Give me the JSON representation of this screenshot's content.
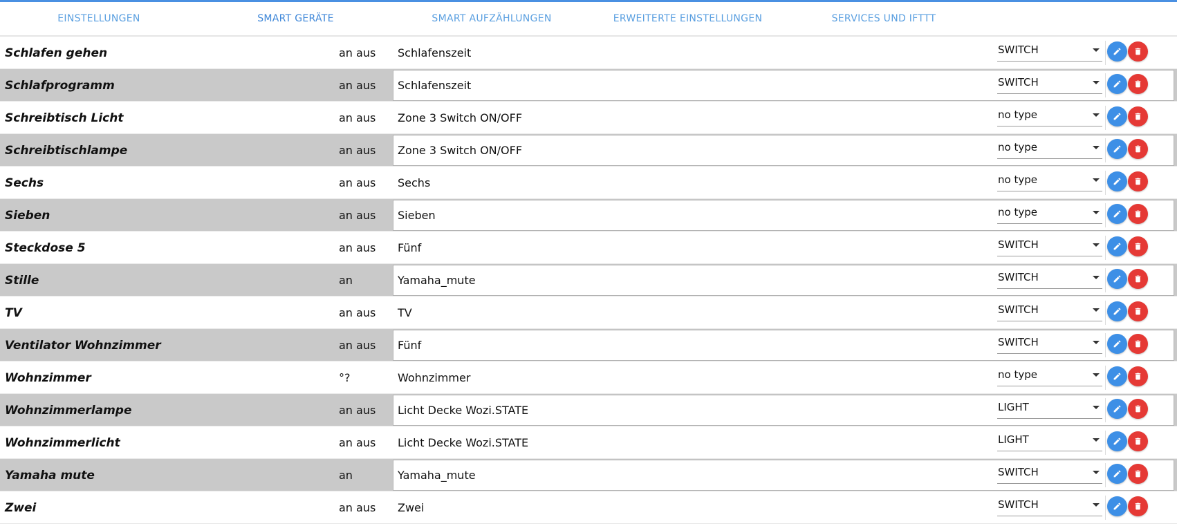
{
  "colors": {
    "accent": "#4a90e2",
    "tab_text": "#5a9fe0",
    "odd_row": "#c9c9c9",
    "edit_button": "#3d8fe6",
    "delete_button": "#e53935"
  },
  "tabs": [
    {
      "label": "EINSTELLUNGEN",
      "active": false
    },
    {
      "label": "SMART GERÄTE",
      "active": true
    },
    {
      "label": "SMART AUFZÄHLUNGEN",
      "active": false
    },
    {
      "label": "ERWEITERTE EINSTELLUNGEN",
      "active": false
    },
    {
      "label": "SERVICES UND IFTTT",
      "active": false
    }
  ],
  "devices": [
    {
      "name": "Schlafen gehen",
      "onoff": "an aus",
      "target": "Schlafenszeit",
      "type": "SWITCH"
    },
    {
      "name": "Schlafprogramm",
      "onoff": "an aus",
      "target": "Schlafenszeit",
      "type": "SWITCH"
    },
    {
      "name": "Schreibtisch Licht",
      "onoff": "an aus",
      "target": "Zone 3 Switch ON/OFF",
      "type": "no type"
    },
    {
      "name": "Schreibtischlampe",
      "onoff": "an aus",
      "target": "Zone 3 Switch ON/OFF",
      "type": "no type"
    },
    {
      "name": "Sechs",
      "onoff": "an aus",
      "target": "Sechs",
      "type": "no type"
    },
    {
      "name": "Sieben",
      "onoff": "an aus",
      "target": "Sieben",
      "type": "no type"
    },
    {
      "name": "Steckdose 5",
      "onoff": "an aus",
      "target": "Fünf",
      "type": "SWITCH"
    },
    {
      "name": "Stille",
      "onoff": "an",
      "target": "Yamaha_mute",
      "type": "SWITCH"
    },
    {
      "name": "TV",
      "onoff": "an aus",
      "target": "TV",
      "type": "SWITCH"
    },
    {
      "name": "Ventilator Wohnzimmer",
      "onoff": "an aus",
      "target": "Fünf",
      "type": "SWITCH"
    },
    {
      "name": "Wohnzimmer",
      "onoff": "°?",
      "target": "Wohnzimmer",
      "type": "no type"
    },
    {
      "name": "Wohnzimmerlampe",
      "onoff": "an aus",
      "target": "Licht Decke Wozi.STATE",
      "type": "LIGHT"
    },
    {
      "name": "Wohnzimmerlicht",
      "onoff": "an aus",
      "target": "Licht Decke Wozi.STATE",
      "type": "LIGHT"
    },
    {
      "name": "Yamaha mute",
      "onoff": "an",
      "target": "Yamaha_mute",
      "type": "SWITCH"
    },
    {
      "name": "Zwei",
      "onoff": "an aus",
      "target": "Zwei",
      "type": "SWITCH"
    }
  ]
}
